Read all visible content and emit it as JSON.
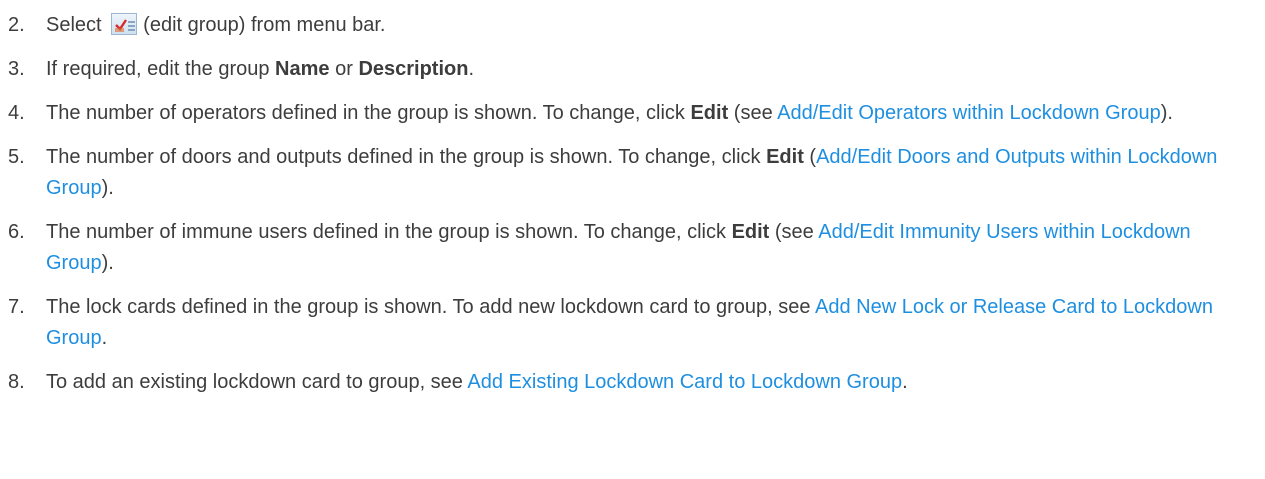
{
  "steps": [
    {
      "num": "2.",
      "pre": "Select",
      "post": "(edit group) from menu bar.",
      "icon": "edit-group-icon"
    },
    {
      "num": "3.",
      "t1": "If required, edit the group ",
      "b1": "Name",
      "t2": " or ",
      "b2": "Description",
      "t3": "."
    },
    {
      "num": "4.",
      "t1": "The number of operators defined in the group is shown. To change, click ",
      "b1": "Edit",
      "t2": " (see ",
      "link": "Add/Edit Operators within Lockdown Group",
      "t3": ")."
    },
    {
      "num": "5.",
      "t1": "The number of doors and outputs defined in the group is shown. To change, click ",
      "b1": "Edit",
      "t2": " (",
      "link": "Add/Edit Doors and Outputs within Lockdown Group",
      "t3": ")."
    },
    {
      "num": "6.",
      "t1": "The number of immune users defined in the group is shown. To change, click ",
      "b1": "Edit",
      "t2": " (see ",
      "link": "Add/Edit Immunity Users within Lockdown Group",
      "t3": ")."
    },
    {
      "num": "7.",
      "t1": "The lock cards defined in the group is shown. To add new lockdown card to group, see ",
      "link": "Add New Lock or Release Card to Lockdown Group",
      "t3": "."
    },
    {
      "num": "8.",
      "t1": "To add an existing lockdown card to group, see ",
      "link": "Add Existing Lockdown Card to Lockdown Group",
      "t3": "."
    }
  ],
  "colors": {
    "text": "#3d3d3d",
    "link": "#1e8fe0"
  }
}
